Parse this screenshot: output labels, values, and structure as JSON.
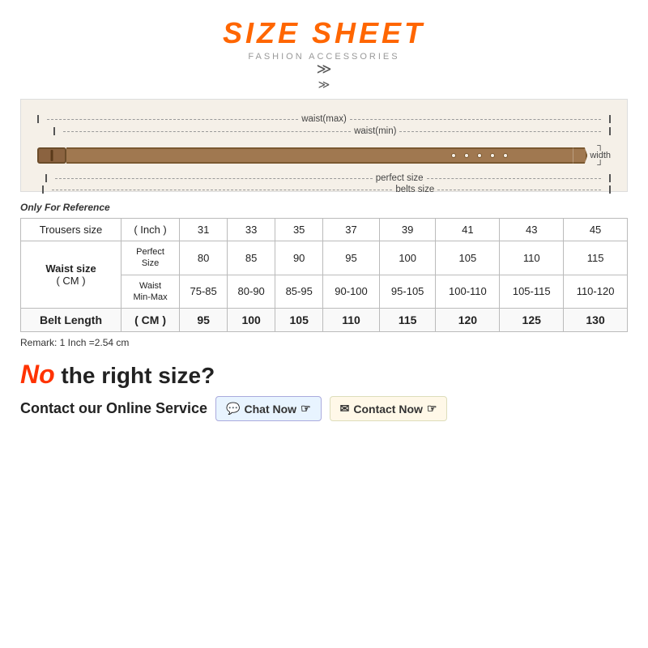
{
  "header": {
    "title": "SIZE SHEET",
    "subtitle": "FASHION ACCESSORIES",
    "chevron": "❯❯"
  },
  "belt_diagram": {
    "rows": [
      {
        "label": "waist(max)",
        "type": "max"
      },
      {
        "label": "waist(min)",
        "type": "min"
      },
      {
        "label": "perfect size",
        "type": "perfect"
      },
      {
        "label": "belts size",
        "type": "belts"
      }
    ],
    "width_label": "width"
  },
  "reference_note": "Only For Reference",
  "table": {
    "col_header": "Trousers size",
    "col_unit": "( Inch )",
    "sizes": [
      "31",
      "33",
      "35",
      "37",
      "39",
      "41",
      "43",
      "45"
    ],
    "waist_label": "Waist size",
    "waist_unit": "( CM )",
    "perfect_label": "Perfect\nSize",
    "waist_minmax_label": "Waist\nMin-Max",
    "perfect_values": [
      "80",
      "85",
      "90",
      "95",
      "100",
      "105",
      "110",
      "115"
    ],
    "minmax_values": [
      "75-85",
      "80-90",
      "85-95",
      "90-100",
      "95-105",
      "100-110",
      "105-115",
      "110-120"
    ],
    "belt_length_label": "Belt Length",
    "belt_length_unit": "( CM )",
    "belt_values": [
      "95",
      "100",
      "105",
      "110",
      "115",
      "120",
      "125",
      "130"
    ]
  },
  "remark": "Remark: 1 Inch =2.54 cm",
  "bottom": {
    "no_text": "No",
    "question_text": " the right size?",
    "contact_label": "Contact our Online Service",
    "chat_btn": "Chat Now",
    "chat_icon": "💬",
    "contact_btn": "Contact Now",
    "mail_icon": "✉",
    "hand_icon": "☞"
  }
}
